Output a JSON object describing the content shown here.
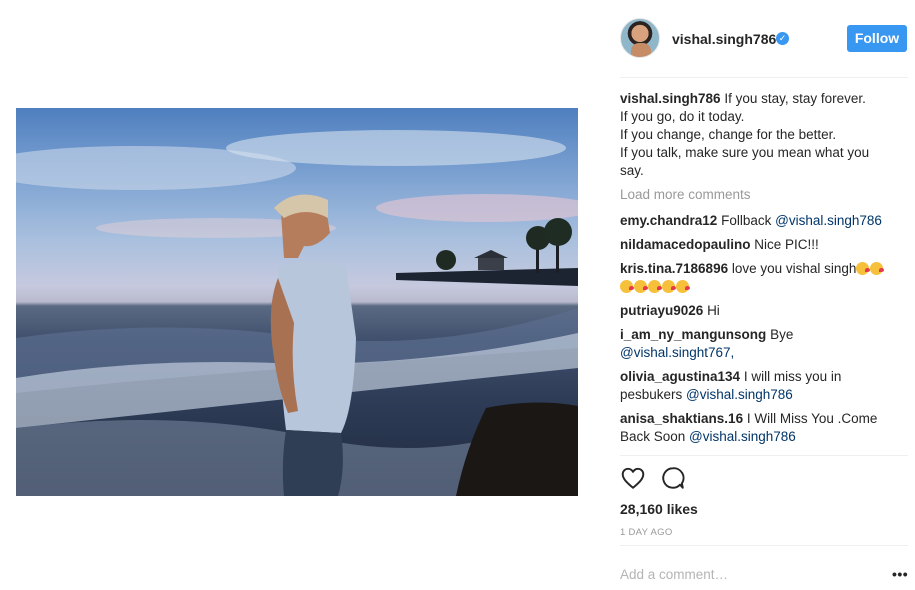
{
  "post": {
    "username": "vishal.singh786",
    "verified": true,
    "follow_label": "Follow",
    "caption": "If you stay, stay forever.\nIf you go, do it today.\nIf you change, change for the better.\nIf you talk, make sure you mean what you say.",
    "load_more": "Load more comments",
    "comments": [
      {
        "user": "emy.chandra12",
        "text": "Follback ",
        "mention": "@vishal.singh786"
      },
      {
        "user": "nildamacedopaulino",
        "text": "Nice PIC!!!",
        "mention": ""
      },
      {
        "user": "kris.tina.7186896",
        "text": "love you vishal singh",
        "mention": "",
        "emoji_count_first_line": 2,
        "emoji_count_second_line": 5
      },
      {
        "user": "putriayu9026",
        "text": "Hi",
        "mention": ""
      },
      {
        "user": "i_am_ny_mangunsong",
        "text": "Bye",
        "mention": "@vishal.singht767,"
      },
      {
        "user": "olivia_agustina134",
        "text": "I will miss you in pesbukers ",
        "mention": "@vishal.singh786"
      },
      {
        "user": "anisa_shaktians.16",
        "text": "I Will Miss You .Come Back Soon ",
        "mention": "@vishal.singh786"
      }
    ],
    "likes": "28,160 likes",
    "date": "1 DAY AGO",
    "comment_placeholder": "Add a comment…",
    "more_label": "•••"
  },
  "colors": {
    "accent": "#3897f0",
    "mention": "#003569",
    "muted": "#999999"
  },
  "icons": [
    "verified-badge-icon",
    "heart-icon",
    "comment-icon",
    "more-options-icon"
  ]
}
